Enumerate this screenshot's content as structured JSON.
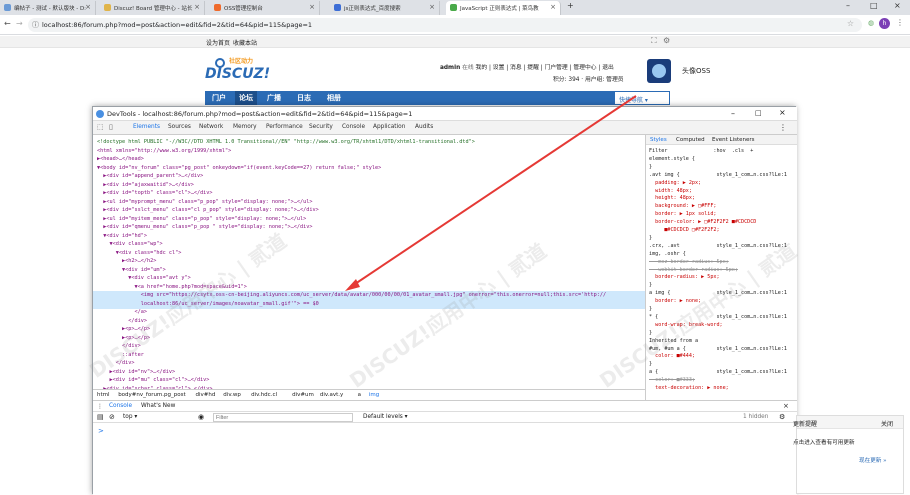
{
  "browser": {
    "tabs": [
      {
        "label": "编帖子 - 测试 - 默认版块 - D:",
        "active": false
      },
      {
        "label": "Discuz! Board 管理中心 - 站长",
        "active": false
      },
      {
        "label": "OSS管理控制台",
        "active": false
      },
      {
        "label": "js正则表达式_百度搜索",
        "active": false
      },
      {
        "label": "JavaScript 正则表达式 | 菜鸟教",
        "active": false
      }
    ],
    "url": "localhost:86/forum.php?mod=post&action=edit&fid=2&tid=64&pid=115&page=1",
    "avatar_letter": "h"
  },
  "page": {
    "topbar_links": [
      "设为首页",
      "收藏本站"
    ],
    "logo_small": "社区动力",
    "logo_big": "DISCUZ!",
    "user": "admin",
    "user_status": "在线",
    "user_links": [
      "我的",
      "设置",
      "消息",
      "提醒",
      "门户管理",
      "管理中心",
      "退出"
    ],
    "user_points": "积分: 394",
    "user_group": "用户组: 管理员",
    "brand_name": "头像OSS",
    "nav": [
      "门户",
      "论坛",
      "广播",
      "日志",
      "相册"
    ],
    "quick_nav": "快捷导航"
  },
  "devtools": {
    "title": "DevTools - localhost:86/forum.php?mod=post&action=edit&fid=2&tid=64&pid=115&page=1",
    "tabs": [
      "Elements",
      "Sources",
      "Network",
      "Memory",
      "Performance",
      "Security",
      "Console",
      "Application",
      "Audits"
    ],
    "dom_lines": [
      "<!doctype html PUBLIC \"-//W3C//DTD XHTML 1.0 Transitional//EN\" \"http://www.w3.org/TR/xhtml1/DTD/xhtml1-transitional.dtd\">",
      "<html xmlns=\"http://www.w3.org/1999/xhtml\">",
      "▶<head>…</head>",
      "▼<body id=\"nv_forum\" class=\"pg_post\" onkeydown=\"if(event.keyCode==27) return false;\" style>",
      "  ▶<div id=\"append_parent\">…</div>",
      "  ▶<div id=\"ajaxwaitid\">…</div>",
      "  ▶<div id=\"toptb\" class=\"cl\">…</div>",
      "  ▶<ul id=\"myprompt_menu\" class=\"p_pop\" style=\"display: none;\">…</ul>",
      "  ▶<div id=\"sslct_menu\" class=\"cl p_pop\" style=\"display: none;\">…</div>",
      "  ▶<ul id=\"myitem_menu\" class=\"p_pop\" style=\"display: none;\">…</ul>",
      "  ▶<div id=\"qmenu_menu\" class=\"p_pop \" style=\"display: none;\">…</div>",
      "  ▼<div id=\"hd\">",
      "    ▼<div class=\"wp\">",
      "      ▼<div class=\"hdc cl\">",
      "        ▶<h2>…</h2>",
      "        ▼<div id=\"um\">",
      "          ▼<div class=\"avt y\">",
      "            ▼<a href=\"home.php?mod=space&uid=1\">",
      "              <img src=\"https://csytx.oss-cn-beijing.aliyuncs.com/uc_server/data/avatar/000/00/00/01_avatar_small.jpg\" onerror=\"this.onerror=null;this.src='http://",
      "              localhost:86/uc_server/images/noavatar_small.gif'\"> == $0",
      "            </a>",
      "          </div>",
      "        ▶<p>…</p>",
      "        ▶<p>…</p>",
      "        </div>",
      "        ::after",
      "      </div>",
      "    ▶<div id=\"nv\">…</div>",
      "    ▶<div id=\"mu\" class=\"cl\">…</div>",
      "  ▶<div id=\"scbar\" class=\"cl\">…</div>"
    ],
    "selected_line": 18,
    "breadcrumbs": [
      "html",
      "body#nv_forum.pg_post",
      "div#hd",
      "div.wp",
      "div.hdc.cl",
      "div#um",
      "div.avt.y",
      "a",
      "img"
    ],
    "styles_tabs": [
      "Styles",
      "Computed",
      "Event Listeners"
    ],
    "styles_lines": [
      "Filter               :hov  .cls  +",
      "element.style {",
      "}",
      ".avt img {            style_1_com…n.css?lLe:1",
      "  padding: ▶ 2px;",
      "  width: 48px;",
      "  height: 48px;",
      "  background: ▶ □#FFF;",
      "  border: ▶ 1px solid;",
      "  border-color: ▶ □#F2F2F2 ■#CDCDCD",
      "     ■#CDCDCD □#F2F2F2;",
      "}",
      ".crx, .avt            style_1_com…n.css?lLe:1",
      "img, .oshr {",
      "  -moz-border-radius: 5px;",
      "  -webkit-border-radius: 5px;",
      "  border-radius: ▶ 5px;",
      "}",
      "a img {               style_1_com…n.css?lLe:1",
      "  border: ▶ none;",
      "}",
      "* {                   style_1_com…n.css?lLe:1",
      "  word-wrap: break-word;",
      "}",
      "Inherited from a",
      "#um, #um a {          style_1_com…n.css?lLe:1",
      "  color: ■#444;",
      "}",
      "a {                   style_1_com…n.css?lLe:1",
      "  color: ■#333;",
      "  text-decoration: ▶ none;"
    ],
    "console_tabs": [
      "Console",
      "What's New"
    ],
    "console_context": "top",
    "console_filter_placeholder": "Filter",
    "console_levels": "Default levels ▾",
    "console_hidden": "1 hidden",
    "console_prompt": ">"
  },
  "side_panel": {
    "title": "更新提醒",
    "close": "关闭",
    "text": "点击进入查看有可用更新",
    "link": "现在更新 »"
  },
  "watermark": "DISCUZ!应用中心 | 贰道"
}
